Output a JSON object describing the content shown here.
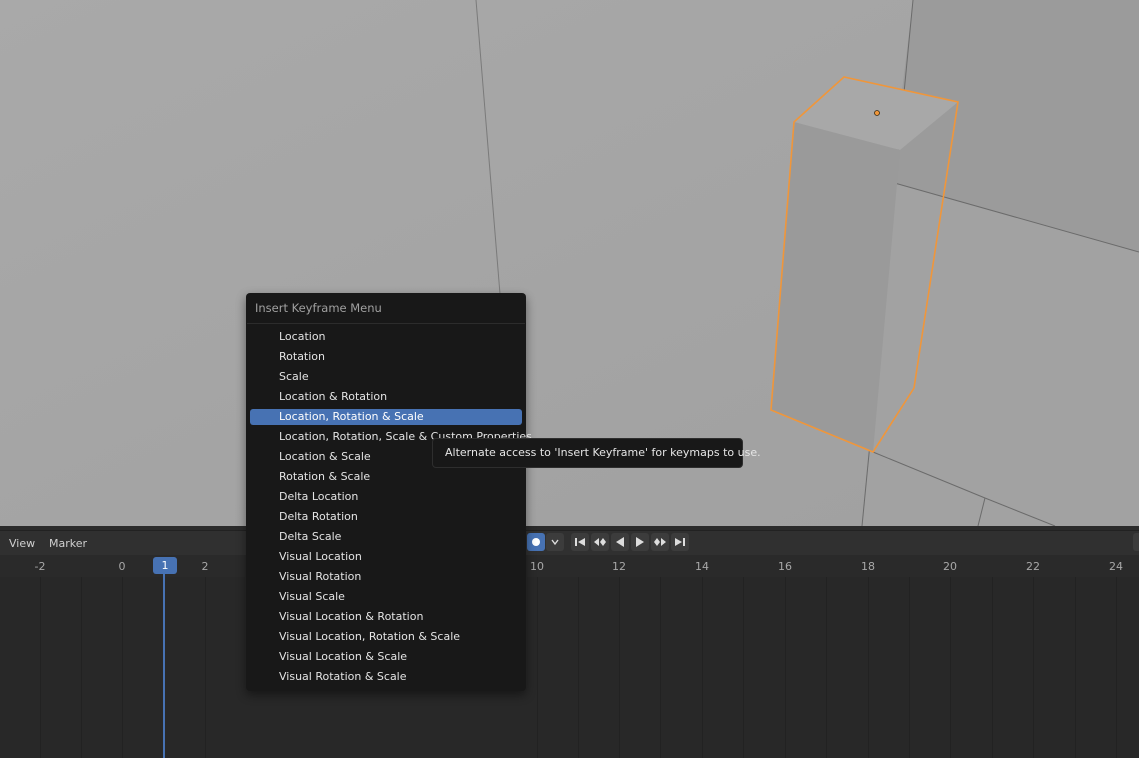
{
  "timeline_header": {
    "menus": [
      "View",
      "Marker"
    ]
  },
  "ruler": {
    "ticks": [
      "-2",
      "0",
      "2",
      "10",
      "12",
      "14",
      "16",
      "18",
      "20",
      "22",
      "24"
    ],
    "current_frame": "1"
  },
  "menu": {
    "title": "Insert Keyframe Menu",
    "items": [
      "Location",
      "Rotation",
      "Scale",
      "Location & Rotation",
      "Location, Rotation & Scale",
      "Location, Rotation, Scale & Custom Properties",
      "Location & Scale",
      "Rotation & Scale",
      "Delta Location",
      "Delta Rotation",
      "Delta Scale",
      "Visual Location",
      "Visual Rotation",
      "Visual Scale",
      "Visual Location & Rotation",
      "Visual Location, Rotation & Scale",
      "Visual Location & Scale",
      "Visual Rotation & Scale"
    ],
    "active_item": "Location, Rotation & Scale"
  },
  "tooltip": {
    "text": "Alternate access to 'Insert Keyframe' for keymaps to use."
  },
  "colors": {
    "accent": "#4772b3",
    "selection_outline": "#f0963a",
    "viewport_bg": "#a5a5a5"
  },
  "icons": {
    "auto_keying": "record-dot-icon",
    "dropdown": "chevron-down-icon",
    "playback": [
      "jump-start-icon",
      "prev-keyframe-icon",
      "play-reverse-icon",
      "play-icon",
      "next-keyframe-icon",
      "jump-end-icon"
    ]
  }
}
